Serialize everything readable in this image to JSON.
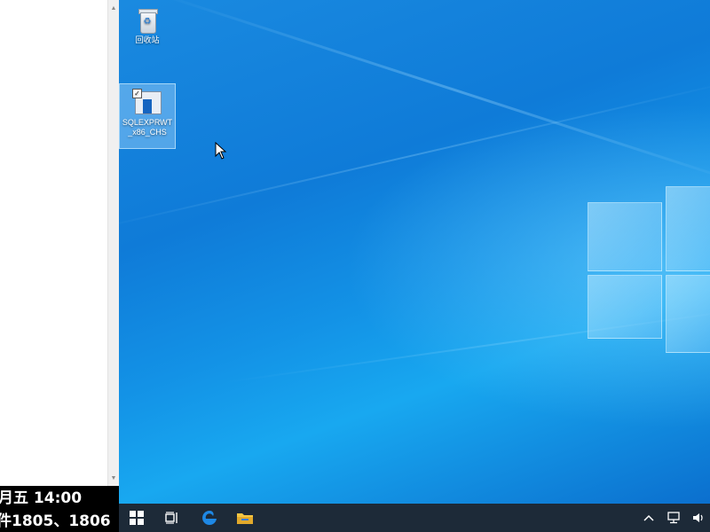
{
  "caption": {
    "line1": "月五 14:00",
    "line2": "件1805、1806"
  },
  "desktop": {
    "icons": [
      {
        "label": "回收站",
        "icon": "recycle-bin-icon"
      },
      {
        "label": "SQLEXPRWT\n_x86_CHS",
        "label_line1": "SQLEXPRWT",
        "label_line2": "_x86_CHS",
        "icon": "installer-icon",
        "selected": true
      }
    ]
  },
  "taskbar": {
    "start": {
      "icon": "windows-start-icon"
    },
    "pinned": [
      {
        "name": "task-view",
        "icon": "task-view-icon"
      },
      {
        "name": "edge",
        "icon": "edge-browser-icon"
      },
      {
        "name": "file-explorer",
        "icon": "folder-icon"
      }
    ],
    "tray": [
      {
        "name": "show-hidden",
        "glyph": "^"
      },
      {
        "name": "network",
        "icon": "network-icon"
      },
      {
        "name": "volume",
        "icon": "speaker-icon"
      }
    ],
    "color": "#1d2a38"
  },
  "colors": {
    "desktop_blue": "#0f7bd8",
    "edge_blue": "#1e88e5",
    "folder_yellow": "#f4c542"
  }
}
